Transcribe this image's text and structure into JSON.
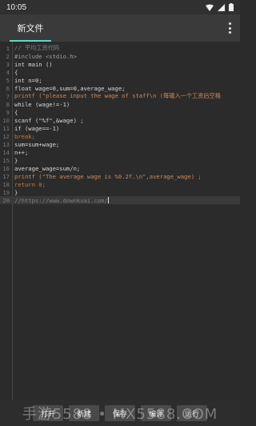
{
  "status": {
    "time": "10:05"
  },
  "toolbar": {
    "tab_label": "新文件"
  },
  "editor": {
    "lines": [
      {
        "n": "1",
        "text": "// 平均工资代码"
      },
      {
        "n": "2",
        "text": "#include <stdio.h>"
      },
      {
        "n": "3",
        "text": "int main ()"
      },
      {
        "n": "4",
        "text": "{"
      },
      {
        "n": "5",
        "text": "int n=0;"
      },
      {
        "n": "6",
        "text": "float wage=0,sum=0,average_wage;"
      },
      {
        "n": "7",
        "text": "printf (\"please input the wage of staff\\n (每输入一个工资后空格"
      },
      {
        "n": "8",
        "text": "while (wage!=-1)"
      },
      {
        "n": "9",
        "text": "{"
      },
      {
        "n": "10",
        "text": "scanf (\"%f\",&wage) ;"
      },
      {
        "n": "11",
        "text": "if (wage==-1)"
      },
      {
        "n": "12",
        "text": "break;"
      },
      {
        "n": "13",
        "text": "sum=sum+wage;"
      },
      {
        "n": "14",
        "text": "n++;"
      },
      {
        "n": "15",
        "text": "}"
      },
      {
        "n": "16",
        "text": "average_wage=sum/n;"
      },
      {
        "n": "17",
        "text": "printf (\"The average wage is %0.2f.\\n\",average_wage) ;"
      },
      {
        "n": "18",
        "text": "return 0;"
      },
      {
        "n": "19",
        "text": "}"
      },
      {
        "n": "20",
        "text": "//https://www.downkuai.com/"
      }
    ]
  },
  "bottom": {
    "open": "打开",
    "new": "新建",
    "save": "保存",
    "compile": "编译",
    "run": "运行"
  },
  "watermark": "手游5588 • MX5588.COM"
}
